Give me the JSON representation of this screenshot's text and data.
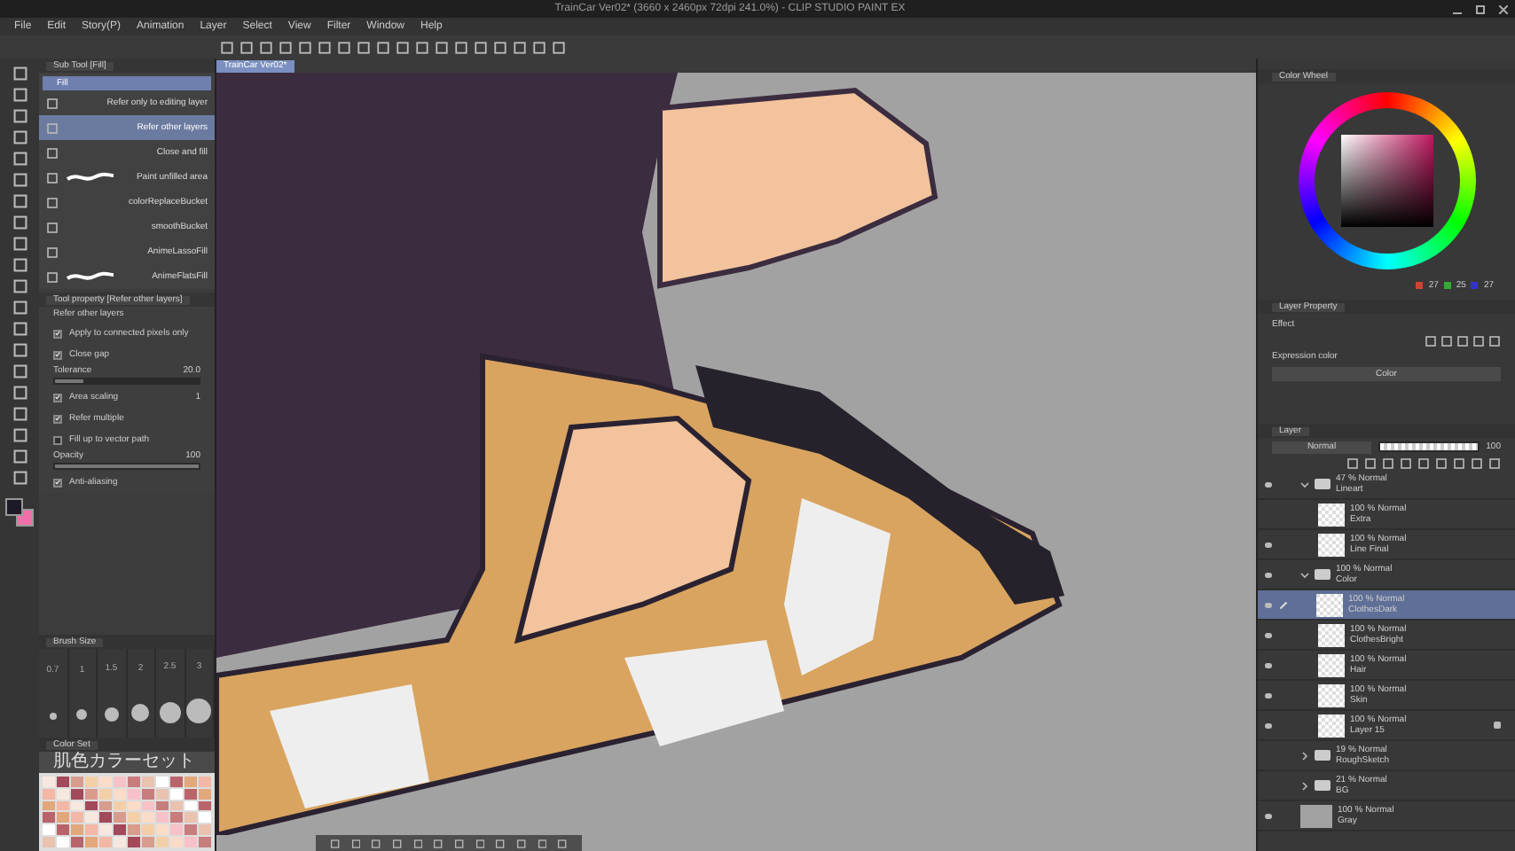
{
  "window": {
    "title": "TrainCar Ver02* (3660 x 2460px 72dpi 241.0%) - CLIP STUDIO PAINT EX"
  },
  "menu": [
    "File",
    "Edit",
    "Story(P)",
    "Animation",
    "Layer",
    "Select",
    "View",
    "Filter",
    "Window",
    "Help"
  ],
  "canvas_tab": {
    "label": "TrainCar Ver02*"
  },
  "drawing_colors": [
    {
      "color": "#1b1a26"
    },
    {
      "color": "#f06fa8"
    }
  ],
  "sub_tool": {
    "title": "Sub Tool [Fill]",
    "group": "Fill",
    "items": [
      {
        "label": "Refer only to editing layer",
        "kind": "icon",
        "selected": false
      },
      {
        "label": "Refer other layers",
        "kind": "icon",
        "selected": true
      },
      {
        "label": "Close and fill",
        "kind": "icon",
        "selected": false
      },
      {
        "label": "Paint unfilled area",
        "kind": "stroke",
        "selected": false
      },
      {
        "label": "colorReplaceBucket",
        "kind": "icon",
        "selected": false
      },
      {
        "label": "smoothBucket",
        "kind": "icon",
        "selected": false
      },
      {
        "label": "AnimeLassoFill",
        "kind": "icon",
        "selected": false
      },
      {
        "label": "AnimeFlatsFill",
        "kind": "stroke",
        "selected": false
      }
    ]
  },
  "tool_property": {
    "title": "Tool property [Refer other layers]",
    "preset": "Refer other layers",
    "rows": [
      {
        "kind": "check",
        "label": "Apply to connected pixels only",
        "checked": true
      },
      {
        "kind": "check",
        "label": "Close gap",
        "checked": true
      },
      {
        "kind": "slider",
        "label": "Tolerance",
        "value": "20.0",
        "level": 0.2
      },
      {
        "kind": "check",
        "label": "Area scaling",
        "checked": true,
        "value": "1"
      },
      {
        "kind": "check",
        "label": "Refer multiple",
        "checked": true
      },
      {
        "kind": "check",
        "label": "Fill up to vector path",
        "checked": false
      },
      {
        "kind": "slider",
        "label": "Opacity",
        "value": "100",
        "level": 1
      },
      {
        "kind": "check",
        "label": "Anti-aliasing",
        "checked": true
      }
    ]
  },
  "brush_size": {
    "title": "Brush Size",
    "sizes": [
      "0.7",
      "1",
      "1.5",
      "2",
      "2.5",
      "3"
    ]
  },
  "color_set": {
    "tab": "Color Set",
    "name": "肌色カラーセット"
  },
  "color_wheel": {
    "tab": "Color Wheel",
    "r": "27",
    "g": "25",
    "b": "27"
  },
  "layer_property": {
    "tab": "Layer Property",
    "effect_label": "Effect",
    "expression_label": "Expression color",
    "expression_value": "Color"
  },
  "layer_panel": {
    "tab": "Layer",
    "blend": "Normal",
    "opacity": "100",
    "opacity_slider": {
      "level": 1
    },
    "layers": [
      {
        "kind": "folder",
        "mode": "47 % Normal",
        "name": "Lineart",
        "expanded": true,
        "visible": true,
        "children": [
          {
            "kind": "layer",
            "mode": "100 % Normal",
            "name": "Extra",
            "visible": false,
            "selected": false,
            "locked": false
          },
          {
            "kind": "layer",
            "mode": "100 % Normal",
            "name": "Line Final",
            "visible": true,
            "selected": false,
            "locked": false
          }
        ]
      },
      {
        "kind": "folder",
        "mode": "100 % Normal",
        "name": "Color",
        "expanded": true,
        "visible": true,
        "children": [
          {
            "kind": "layer",
            "mode": "100 % Normal",
            "name": "ClothesDark",
            "visible": true,
            "selected": true,
            "locked": false
          },
          {
            "kind": "layer",
            "mode": "100 % Normal",
            "name": "ClothesBright",
            "visible": true,
            "selected": false,
            "locked": false
          },
          {
            "kind": "layer",
            "mode": "100 % Normal",
            "name": "Hair",
            "visible": true,
            "selected": false,
            "locked": false
          },
          {
            "kind": "layer",
            "mode": "100 % Normal",
            "name": "Skin",
            "visible": true,
            "selected": false,
            "locked": false
          },
          {
            "kind": "layer",
            "mode": "100 % Normal",
            "name": "Layer 15",
            "visible": true,
            "selected": false,
            "locked": true
          }
        ]
      },
      {
        "kind": "folder",
        "mode": "19 % Normal",
        "name": "RoughSketch",
        "expanded": false,
        "visible": false
      },
      {
        "kind": "folder",
        "mode": "21 % Normal",
        "name": "BG",
        "expanded": false,
        "visible": false
      },
      {
        "kind": "paper",
        "mode": "100 % Normal",
        "name": "Gray",
        "visible": true,
        "selected": false,
        "locked": false
      }
    ]
  }
}
